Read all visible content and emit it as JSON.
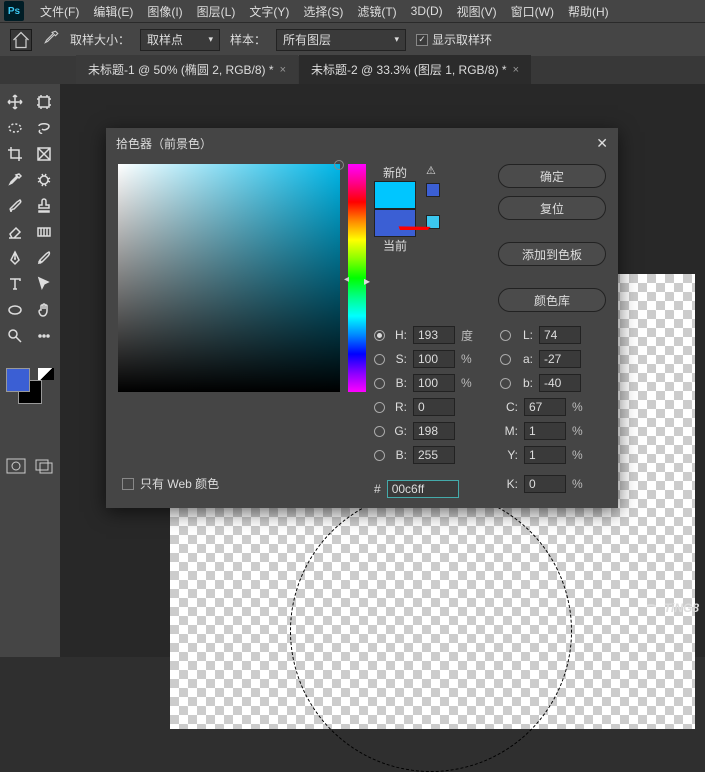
{
  "menu": [
    "文件(F)",
    "编辑(E)",
    "图像(I)",
    "图层(L)",
    "文字(Y)",
    "选择(S)",
    "滤镜(T)",
    "3D(D)",
    "视图(V)",
    "窗口(W)",
    "帮助(H)"
  ],
  "optbar": {
    "sample_size_label": "取样大小：",
    "sample_size_value": "取样点",
    "sample_label": "样本：",
    "sample_value": "所有图层",
    "ring_label": "显示取样环"
  },
  "tabs": [
    {
      "label": "未标题-1 @ 50% (椭圆 2, RGB/8) *",
      "active": false
    },
    {
      "label": "未标题-2 @ 33.3% (图层 1, RGB/8) *",
      "active": true
    }
  ],
  "dialog": {
    "title": "拾色器（前景色）",
    "new_label": "新的",
    "current_label": "当前",
    "ok": "确定",
    "reset": "复位",
    "add_swatch": "添加到色板",
    "lib": "颜色库",
    "web_only": "只有 Web 颜色",
    "hex_label": "#",
    "hex": "00c6ff",
    "H": {
      "v": "193",
      "u": "度"
    },
    "S": {
      "v": "100",
      "u": "%"
    },
    "Bv": {
      "v": "100",
      "u": "%"
    },
    "L": {
      "v": "74",
      "u": ""
    },
    "a": {
      "v": "-27",
      "u": ""
    },
    "bl": {
      "v": "-40",
      "u": ""
    },
    "R": {
      "v": "0",
      "u": ""
    },
    "G": {
      "v": "198",
      "u": ""
    },
    "Bc": {
      "v": "255",
      "u": ""
    },
    "C": {
      "v": "67",
      "u": "%"
    },
    "M": {
      "v": "1",
      "u": "%"
    },
    "Y": {
      "v": "1",
      "u": "%"
    },
    "K": {
      "v": "0",
      "u": "%"
    },
    "preview": {
      "new": "#00c6ff",
      "current": "#3b5fd4",
      "extra1": "#3b5fd4",
      "extra2": "#3bc7ef"
    }
  },
  "watermark": "TiNG8"
}
